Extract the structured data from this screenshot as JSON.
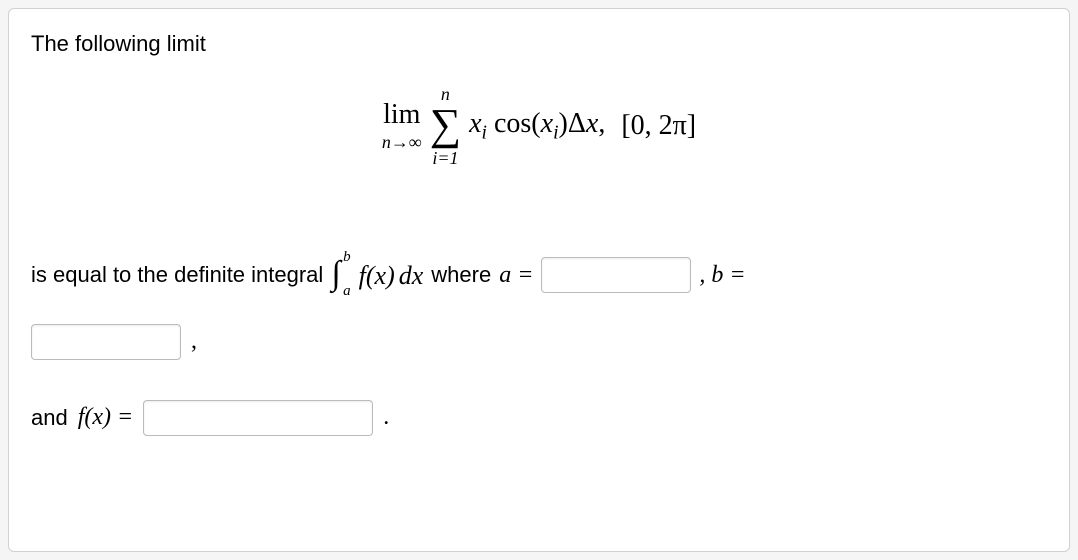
{
  "intro": "The following limit",
  "math": {
    "lim_label": "lim",
    "lim_sub": "n→∞",
    "sum_top": "n",
    "sum_sigma": "∑",
    "sum_bottom": "i=1",
    "summand_xi": "x",
    "summand_xi_sub": "i",
    "summand_cos": " cos(",
    "summand_xi2": "x",
    "summand_xi2_sub": "i",
    "summand_close": ")Δ",
    "summand_dx_x": "x",
    "summand_dx_comma": ",",
    "interval": "[0, 2π]"
  },
  "line2_pre": "is equal to the definite integral",
  "integral": {
    "symbol": "∫",
    "upper": "b",
    "lower": "a",
    "fx": "f(x)",
    "dx": "dx"
  },
  "where_text": "where",
  "a_eq": "a =",
  "b_eq": ", b =",
  "comma": ",",
  "and_fx": "and f(x) =",
  "period": ".",
  "inputs": {
    "a_value": "",
    "b_value": "",
    "fx_value": ""
  }
}
